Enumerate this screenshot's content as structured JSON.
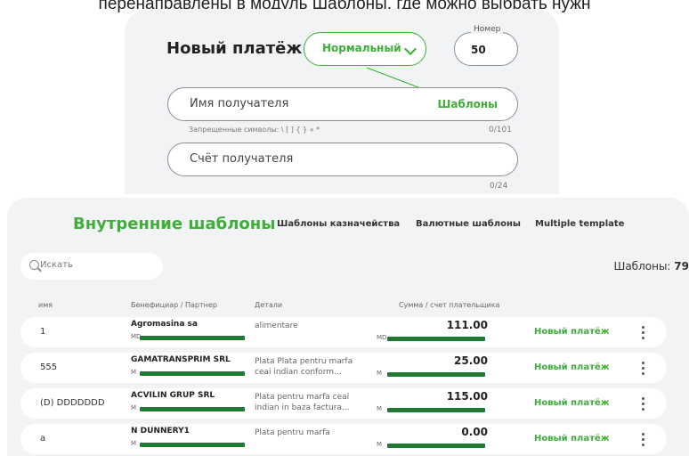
{
  "caption": "перенаправлены в модуль Шаблоны, где можно выбрать нужн",
  "new_payment": {
    "title": "Новый платёж",
    "type_value": "Нормальный",
    "number_label": "Номер",
    "number_value": "50",
    "recipient_placeholder": "Имя получателя",
    "templates_link": "Шаблоны",
    "forbidden_hint": "Запрещенные символы: \\ [ ] { } « *",
    "recipient_counter": "0/101",
    "account_placeholder": "Счёт получателя",
    "account_counter": "0/24"
  },
  "templates": {
    "tabs": [
      "Внутренние шаблоны",
      "Шаблоны казначейства",
      "Валютные шаблоны",
      "Multiple template"
    ],
    "search_placeholder": "Искать",
    "count_label": "Шаблоны:",
    "count_value": "79",
    "columns": [
      "имя",
      "Бенефициар / Партнер",
      "Детали",
      "Сумма / счет плательщика"
    ],
    "rows": [
      {
        "name": "1",
        "beneficiary": "Agromasina sa",
        "ben_prefix": "MD",
        "details_1": "alimentare",
        "details_2": "",
        "amount": "111.00",
        "acc_prefix": "MD",
        "action": "Новый платёж"
      },
      {
        "name": "555",
        "beneficiary": "GAMATRANSPRIM SRL",
        "ben_prefix": "M",
        "details_1": "Plata Plata pentru marfa",
        "details_2": "ceai indian conform...",
        "amount": "25.00",
        "acc_prefix": "M",
        "action": "Новый платёж"
      },
      {
        "name": "(D) DDDDDDD",
        "beneficiary": "ACVILIN GRUP SRL",
        "ben_prefix": "M",
        "details_1": "Plata pentru marfa ceai",
        "details_2": "indian in baza factura...",
        "amount": "115.00",
        "acc_prefix": "M",
        "action": "Новый платёж"
      },
      {
        "name": "a",
        "beneficiary": "N DUNNERY1",
        "ben_prefix": "M",
        "details_1": "Plata pentru marfa",
        "details_2": "",
        "amount": "0.00",
        "acc_prefix": "M",
        "action": "Новый платёж"
      }
    ]
  },
  "colors": {
    "accent": "#3fae3a",
    "redaction": "#1f7a2f",
    "panel_bg": "#f2f3f5"
  },
  "icons": {
    "dropdown": "chevron-down-icon",
    "search": "search-icon",
    "row_menu": "more-vertical-icon"
  }
}
